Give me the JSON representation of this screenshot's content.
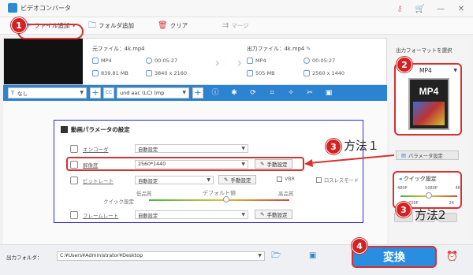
{
  "window": {
    "title": "ビデオコンバータ"
  },
  "toolbar": {
    "add_file": "ファイル追加",
    "add_folder": "フォルダ追加",
    "clear": "クリア",
    "merge": "マージ"
  },
  "file": {
    "source_label": "元ファイル：",
    "source_name": "4k.mp4",
    "output_label": "出力ファイル：",
    "output_name": "4k.mp4",
    "src_format": "MP4",
    "src_duration": "00:05:27",
    "src_size": "839.81 MB",
    "src_resolution": "3840 x 2160",
    "out_format": "MP4",
    "out_duration": "00:05:27",
    "out_size": "505 MB",
    "out_resolution": "2560 x 1440"
  },
  "editbar": {
    "subtitle_select": "なし",
    "audio_select": "und aac (LC) (mp"
  },
  "params": {
    "title": "動画パラメータの設定",
    "encoder_label": "エンコーダ",
    "encoder_value": "自動設定",
    "resolution_label": "解像度",
    "resolution_value": "2560*1440",
    "manual_label": "手動設定",
    "bitrate_label": "ビットレート",
    "bitrate_value": "自動設定",
    "vbr_label": "VBR",
    "lossless_label": "ロスレスモード",
    "low_quality": "低品質",
    "default_label": "デフォルト値",
    "high_quality": "高品質",
    "quick_setting": "クイック設定",
    "framerate_label": "フレームレート",
    "framerate_value": "自動設定"
  },
  "right": {
    "select_format": "出力フォーマットを選択",
    "format": "MP4",
    "format_icon_text": "MP4",
    "param_button": "パラメータ設定",
    "quick_title": "クイック設定",
    "ticks_top": [
      "480P",
      "1080P",
      "4K"
    ],
    "ticks_bottom": [
      "720P",
      "2K"
    ]
  },
  "bottom": {
    "output_folder_label": "出力フォルダ：",
    "output_path": "C:¥Users¥Administrator¥Desktop",
    "convert": "変換"
  },
  "annotations": {
    "n1": "1",
    "n2": "2",
    "n3": "3",
    "n3b": "3",
    "n4": "4",
    "method1": "方法１",
    "method2": "方法2"
  },
  "colors": {
    "accent": "#2c83d1",
    "annotation_red": "#d63131"
  }
}
